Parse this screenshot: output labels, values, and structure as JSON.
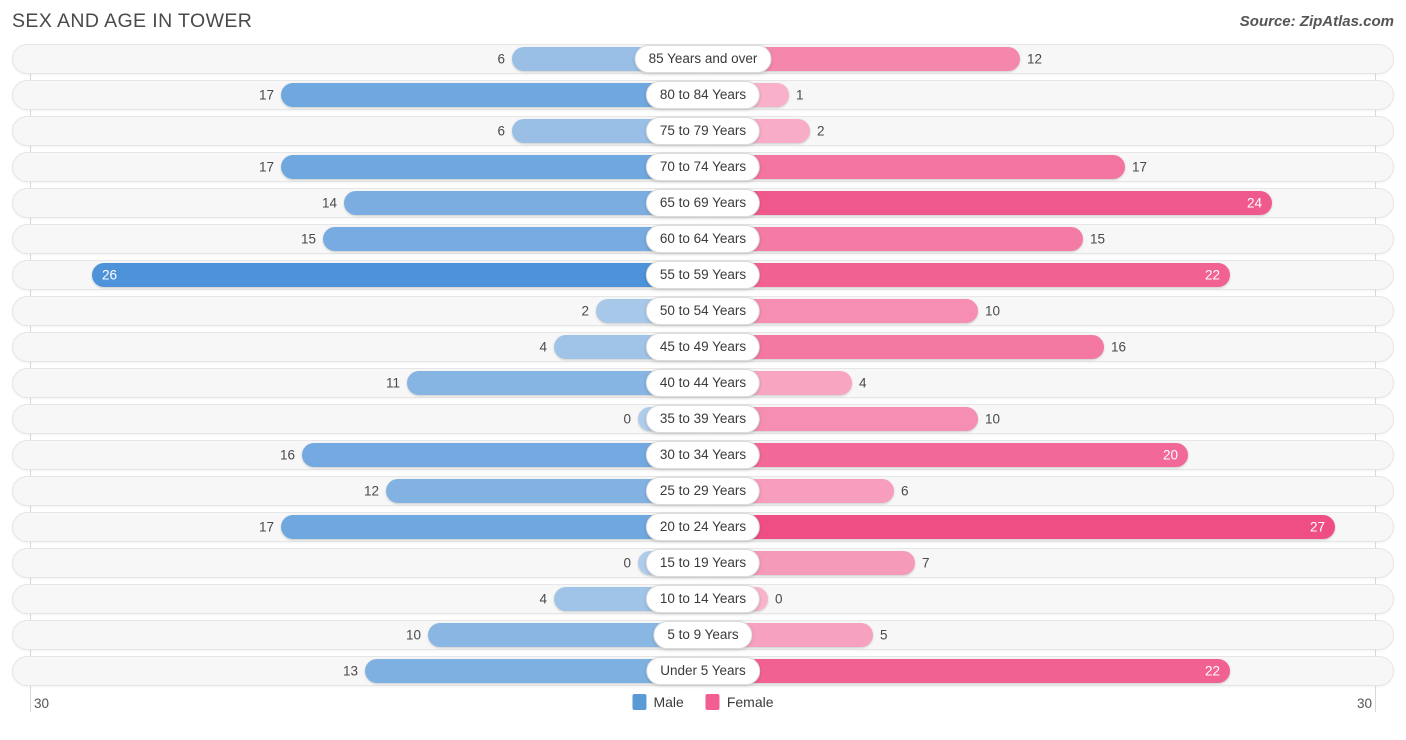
{
  "header": {
    "title": "SEX AND AGE IN TOWER",
    "source": "Source: ZipAtlas.com"
  },
  "legend": {
    "male_label": "Male",
    "female_label": "Female",
    "male_color": "#5b9bd5",
    "female_color": "#f25e92"
  },
  "axis": {
    "left_label": "30",
    "right_label": "30",
    "max": 30
  },
  "chart_data": {
    "type": "bar",
    "title": "SEX AND AGE IN TOWER",
    "subtitle": "Source: ZipAtlas.com",
    "orientation": "horizontal",
    "layout": "population-pyramid",
    "xlabel": "",
    "ylabel": "",
    "xlim": [
      30,
      30
    ],
    "grid": false,
    "legend_position": "bottom-center",
    "categories": [
      "85 Years and over",
      "80 to 84 Years",
      "75 to 79 Years",
      "70 to 74 Years",
      "65 to 69 Years",
      "60 to 64 Years",
      "55 to 59 Years",
      "50 to 54 Years",
      "45 to 49 Years",
      "40 to 44 Years",
      "35 to 39 Years",
      "30 to 34 Years",
      "25 to 29 Years",
      "20 to 24 Years",
      "15 to 19 Years",
      "10 to 14 Years",
      "5 to 9 Years",
      "Under 5 Years"
    ],
    "series": [
      {
        "name": "Male",
        "color": "#5b9bd5",
        "values": [
          6,
          17,
          6,
          17,
          14,
          15,
          26,
          2,
          4,
          11,
          0,
          16,
          12,
          17,
          0,
          4,
          10,
          13
        ]
      },
      {
        "name": "Female",
        "color": "#f25e92",
        "values": [
          12,
          1,
          2,
          17,
          24,
          15,
          22,
          10,
          16,
          4,
          10,
          20,
          6,
          27,
          7,
          0,
          5,
          22
        ]
      }
    ]
  },
  "rows": [
    {
      "label": "85 Years and over",
      "male": 6,
      "female": 12,
      "male_inside": false,
      "female_inside": false
    },
    {
      "label": "80 to 84 Years",
      "male": 17,
      "female": 1,
      "male_inside": false,
      "female_inside": false
    },
    {
      "label": "75 to 79 Years",
      "male": 6,
      "female": 2,
      "male_inside": false,
      "female_inside": false
    },
    {
      "label": "70 to 74 Years",
      "male": 17,
      "female": 17,
      "male_inside": false,
      "female_inside": false
    },
    {
      "label": "65 to 69 Years",
      "male": 14,
      "female": 24,
      "male_inside": false,
      "female_inside": true
    },
    {
      "label": "60 to 64 Years",
      "male": 15,
      "female": 15,
      "male_inside": false,
      "female_inside": false
    },
    {
      "label": "55 to 59 Years",
      "male": 26,
      "female": 22,
      "male_inside": true,
      "female_inside": true
    },
    {
      "label": "50 to 54 Years",
      "male": 2,
      "female": 10,
      "male_inside": false,
      "female_inside": false
    },
    {
      "label": "45 to 49 Years",
      "male": 4,
      "female": 16,
      "male_inside": false,
      "female_inside": false
    },
    {
      "label": "40 to 44 Years",
      "male": 11,
      "female": 4,
      "male_inside": false,
      "female_inside": false
    },
    {
      "label": "35 to 39 Years",
      "male": 0,
      "female": 10,
      "male_inside": false,
      "female_inside": false
    },
    {
      "label": "30 to 34 Years",
      "male": 16,
      "female": 20,
      "male_inside": false,
      "female_inside": true
    },
    {
      "label": "25 to 29 Years",
      "male": 12,
      "female": 6,
      "male_inside": false,
      "female_inside": false
    },
    {
      "label": "20 to 24 Years",
      "male": 17,
      "female": 27,
      "male_inside": false,
      "female_inside": true
    },
    {
      "label": "15 to 19 Years",
      "male": 0,
      "female": 7,
      "male_inside": false,
      "female_inside": false
    },
    {
      "label": "10 to 14 Years",
      "male": 4,
      "female": 0,
      "male_inside": false,
      "female_inside": false
    },
    {
      "label": "5 to 9 Years",
      "male": 10,
      "female": 5,
      "male_inside": false,
      "female_inside": false
    },
    {
      "label": "Under 5 Years",
      "male": 13,
      "female": 22,
      "male_inside": false,
      "female_inside": true
    }
  ]
}
